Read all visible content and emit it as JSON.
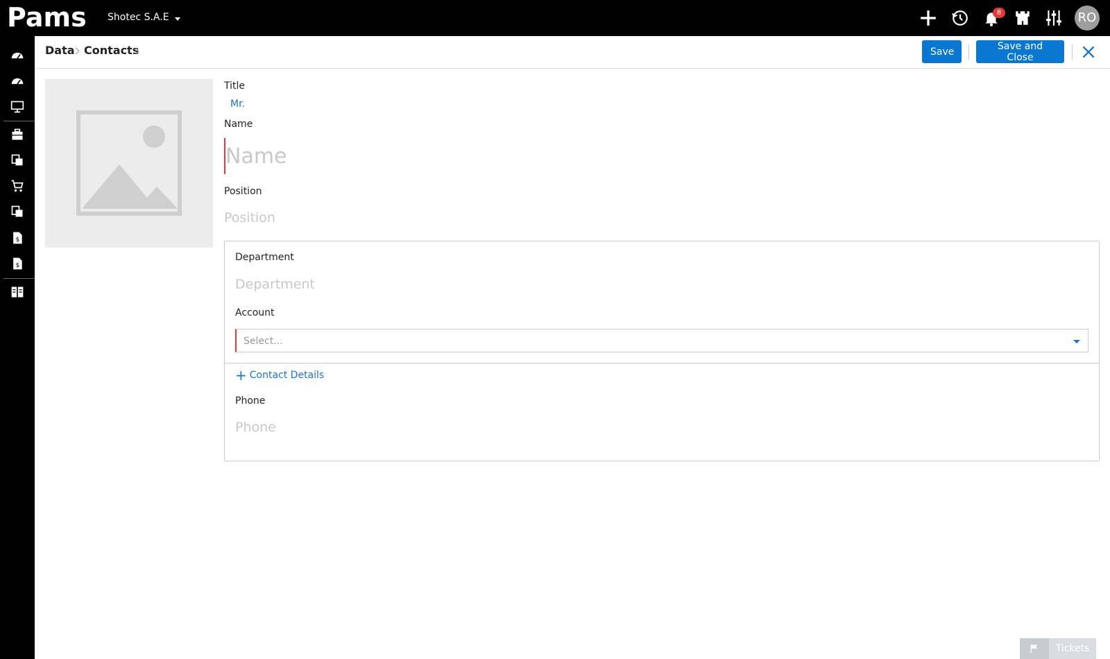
{
  "topbar": {
    "logo_text": "Pams",
    "company_name": "Shotec S.A.E",
    "notifications_count": "8",
    "avatar_initials": "RO",
    "icons": [
      "plus-icon",
      "history-icon",
      "bell-icon",
      "castle-icon",
      "sliders-icon"
    ]
  },
  "sidebar": {
    "items": [
      "dashboard-icon",
      "dashboard-icon",
      "monitor-icon",
      "briefcase-icon",
      "documents-icon",
      "cart-icon",
      "documents-icon",
      "invoice-icon",
      "invoice-icon",
      "layout-icon"
    ]
  },
  "breadcrumb": {
    "items": [
      "Data",
      "Contacts"
    ]
  },
  "actions": {
    "save_label": "Save",
    "save_close_label": "Save and Close"
  },
  "form": {
    "title_label": "Title",
    "title_value": "Mr.",
    "name_label": "Name",
    "name_placeholder": "Name",
    "position_label": "Position",
    "position_placeholder": "Position",
    "department_label": "Department",
    "department_placeholder": "Department",
    "account_label": "Account",
    "account_placeholder": "Select...",
    "contact_details_label": "Contact Details",
    "phone_label": "Phone",
    "phone_placeholder": "Phone"
  },
  "tickets": {
    "label": "Tickets"
  },
  "colors": {
    "accent": "#0a78d2",
    "link": "#1a73c9",
    "required": "#e53935",
    "topbar": "#000000"
  }
}
